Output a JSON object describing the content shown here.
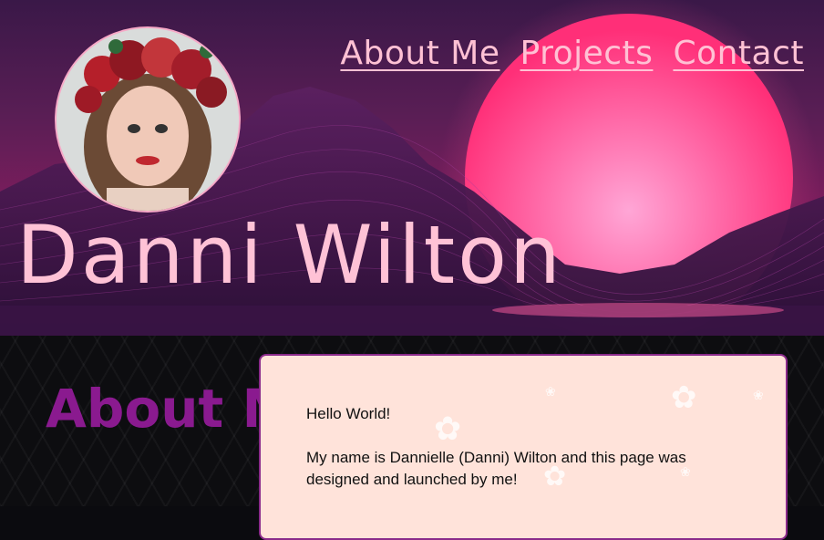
{
  "nav": {
    "items": [
      {
        "label": "About Me"
      },
      {
        "label": "Projects"
      },
      {
        "label": "Contact"
      }
    ]
  },
  "hero": {
    "title": "Danni Wilton"
  },
  "about": {
    "heading": "About Me",
    "greeting": "Hello World!",
    "intro": "My name is Dannielle (Danni) Wilton and this page was designed and launched by me!"
  },
  "colors": {
    "nav_link": "#ffc1d4",
    "title": "#ffc2d6",
    "about_heading": "#8a1a8f",
    "card_bg": "#ffe3da",
    "card_border": "#8a2a8a"
  }
}
